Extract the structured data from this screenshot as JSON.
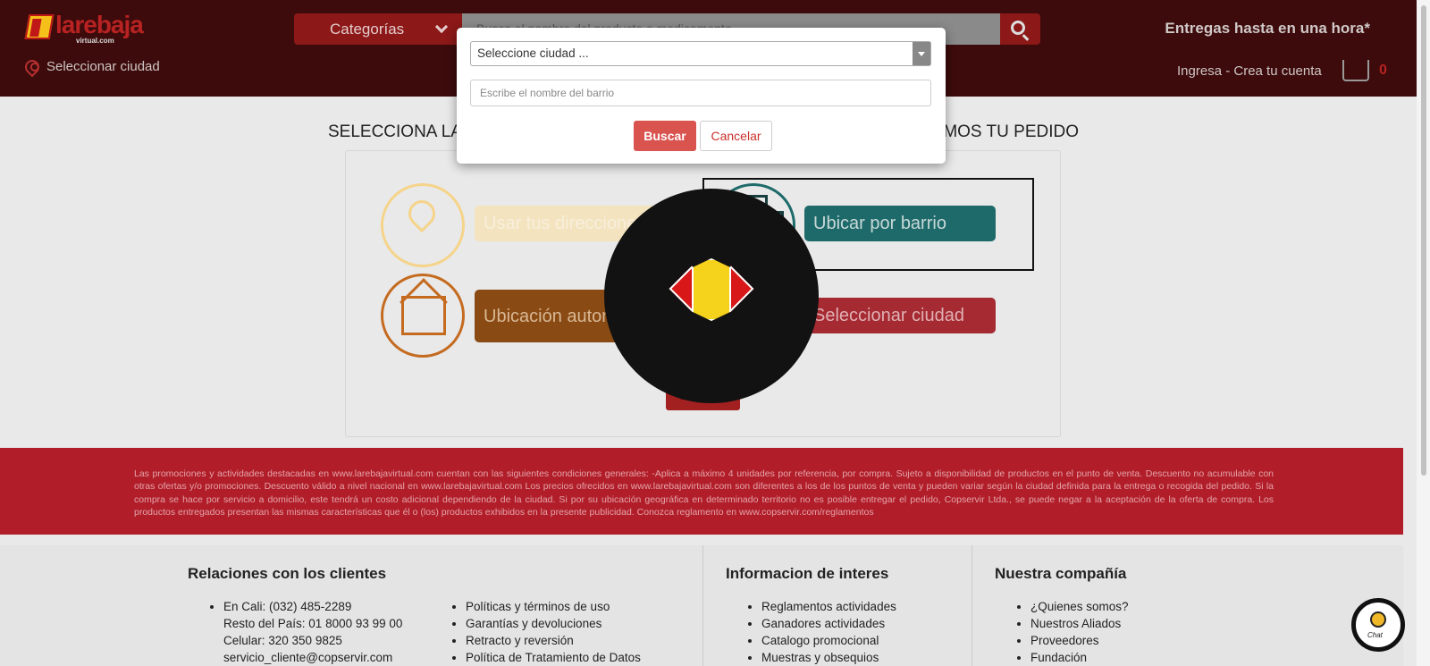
{
  "header": {
    "logo_text": "larebaja",
    "logo_sub": "virtual.com",
    "categories_label": "Categorías",
    "search_placeholder": "Busca el nombre del producto o medicamento",
    "delivery_text": "Entregas hasta en una hora*",
    "select_city_label": "Seleccionar ciudad",
    "login_label": "Ingresa - Crea tu cuenta",
    "cart_count": "0"
  },
  "main": {
    "title_left": "SELECCIONA LA",
    "title_right": "MOS TU PEDIDO",
    "options": [
      {
        "label": "Usar tus direcciones",
        "icon": "map-pin-icon",
        "color": "#f5d48a"
      },
      {
        "label": "Ubicar por barrio",
        "icon": "buildings-icon",
        "color": "#1e6a6a"
      },
      {
        "label": "Ubicación automática",
        "icon": "house-icon",
        "color": "#c46b20"
      },
      {
        "label": "Seleccionar ciudad",
        "icon": "city-pin-icon",
        "color": "#a52a32"
      }
    ],
    "cancel_label": "Cancelar"
  },
  "disclaimer": "Las promociones y actividades destacadas en www.larebajavirtual.com cuentan con las siguientes condiciones generales: -Aplica a máximo 4 unidades por referencia, por compra. Sujeto a disponibilidad de productos en el punto de venta. Descuento no acumulable con otras ofertas y/o promociones. Descuento válido a nivel nacional en www.larebajavirtual.com Los precios ofrecidos en www.larebajavirtual.com son diferentes a los de los puntos de venta y pueden variar según la ciudad definida para la entrega o recogida del pedido. Si la compra se hace por servicio a domicilio, este tendrá un costo adicional dependiendo de la ciudad. Si por su ubicación geográfica en determinado territorio no es posible entregar el pedido, Copservir Ltda., se puede negar a la aceptación de la oferta de compra. Los productos entregados presentan las mismas características que él o (los) productos exhibidos en la presente publicidad. Conozca reglamento en www.copservir.com/reglamentos",
  "footer": {
    "col1_title": "Relaciones con los clientes",
    "col1_items": [
      "En Cali: (032) 485-2289",
      "Resto del País: 01 8000 93 99 00",
      "Celular: 320 350 9825",
      "servicio_cliente@copservir.com"
    ],
    "col1b_items": [
      "Políticas y términos de uso",
      "Garantías y devoluciones",
      "Retracto y reversión",
      "Política de Tratamiento de Datos"
    ],
    "col2_title": "Informacion de interes",
    "col2_items": [
      "Reglamentos actividades",
      "Ganadores actividades",
      "Catalogo promocional",
      "Muestras y obsequios"
    ],
    "col3_title": "Nuestra compañía",
    "col3_items": [
      "¿Quienes somos?",
      "Nuestros Aliados",
      "Proveedores",
      "Fundación"
    ]
  },
  "chat": {
    "label": "Chat"
  },
  "modal": {
    "city_select_value": "Seleccione ciudad ...",
    "barrio_placeholder": "Escribe el nombre del barrio",
    "search_button": "Buscar",
    "cancel_button": "Cancelar"
  },
  "colors": {
    "header_bg": "#3d0b0b",
    "brand_red": "#b11e2a",
    "teal": "#1e6a6a",
    "orange": "#c46b20"
  }
}
